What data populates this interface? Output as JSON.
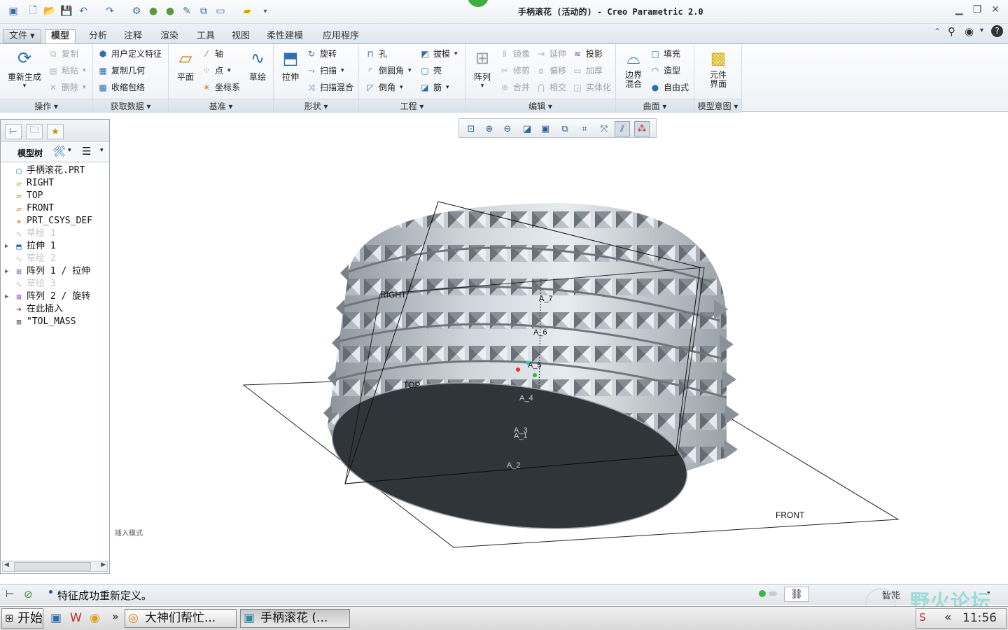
{
  "window": {
    "title": "手柄滚花 (活动的) - Creo Parametric 2.0"
  },
  "quick_access": [
    "app-icon",
    "new-icon",
    "open-icon",
    "save-icon",
    "undo-icon",
    "redo-icon",
    "regenerate-icon",
    "sphere-icon",
    "sphere-icon",
    "edit-icon",
    "copy-icon",
    "window-icon",
    "folder-icon",
    "more-icon"
  ],
  "tabs": {
    "file": "文件",
    "items": [
      "模型",
      "分析",
      "注释",
      "渲染",
      "工具",
      "视图",
      "柔性建模",
      "应用程序"
    ],
    "active": "模型"
  },
  "ribbon": {
    "operations": {
      "label": "操作",
      "regenerate": "重新生成",
      "copy": "复制",
      "paste": "粘贴",
      "delete": "删除"
    },
    "get_data": {
      "label": "获取数据",
      "udf": "用户定义特征",
      "copy_geom": "复制几何",
      "shrinkwrap": "收缩包络"
    },
    "datum": {
      "label": "基准",
      "plane": "平面",
      "axis": "轴",
      "point": "点",
      "csys": "坐标系",
      "sketch": "草绘"
    },
    "shapes": {
      "label": "形状",
      "extrude": "拉伸",
      "revolve": "旋转",
      "sweep": "扫描",
      "swept_blend": "扫描混合"
    },
    "engineering": {
      "label": "工程",
      "hole": "孔",
      "round": "倒圆角",
      "chamfer": "倒角",
      "draft": "拔模",
      "shell": "壳",
      "rib": "筋"
    },
    "editing": {
      "label": "编辑",
      "pattern": "阵列",
      "mirror": "镜像",
      "extend": "延伸",
      "project": "投影",
      "trim": "修剪",
      "offset": "偏移",
      "thicken": "加厚",
      "merge": "合并",
      "intersect": "相交",
      "solidify": "实体化"
    },
    "surfaces": {
      "label": "曲面",
      "boundary_blend": "边界\n混合",
      "fill": "填充",
      "style": "造型",
      "freestyle": "自由式"
    },
    "model_intent": {
      "label": "模型意图",
      "component_interface": "元件\n界面"
    }
  },
  "model_tree": {
    "header": "模型树",
    "items": [
      {
        "label": "手柄滚花.PRT",
        "icon": "part-icon",
        "expandable": false,
        "dim": false
      },
      {
        "label": "RIGHT",
        "icon": "datum-plane-icon",
        "expandable": false,
        "dim": false
      },
      {
        "label": "TOP",
        "icon": "datum-plane-icon",
        "expandable": false,
        "dim": false
      },
      {
        "label": "FRONT",
        "icon": "datum-plane-icon",
        "expandable": false,
        "dim": false
      },
      {
        "label": "PRT_CSYS_DEF",
        "icon": "csys-icon",
        "expandable": false,
        "dim": false
      },
      {
        "label": "草绘 1",
        "icon": "sketch-icon",
        "expandable": false,
        "dim": true
      },
      {
        "label": "拉伸 1",
        "icon": "extrude-icon",
        "expandable": true,
        "dim": false
      },
      {
        "label": "草绘 2",
        "icon": "sketch-icon",
        "expandable": false,
        "dim": true
      },
      {
        "label": "阵列 1 / 拉伸",
        "icon": "pattern-icon",
        "expandable": true,
        "dim": false
      },
      {
        "label": "草绘 3",
        "icon": "sketch-icon",
        "expandable": false,
        "dim": true
      },
      {
        "label": "阵列 2 / 旋转",
        "icon": "pattern-icon",
        "expandable": true,
        "dim": false
      },
      {
        "label": "在此插入",
        "icon": "insert-arrow-icon",
        "expandable": false,
        "dim": false
      },
      {
        "label": "\"TOL_MASS",
        "icon": "analysis-icon",
        "expandable": false,
        "dim": false
      }
    ]
  },
  "graphics": {
    "mode_label": "插入模式",
    "datum_labels": [
      "RIGHT",
      "TOP",
      "FRONT"
    ],
    "axis_labels": [
      "A_7",
      "A_6",
      "A_5",
      "A_4",
      "A_3",
      "A_1",
      "A_2"
    ]
  },
  "status": {
    "message": "特征成功重新定义。",
    "filter": "智能"
  },
  "taskbar": {
    "start": "开始",
    "items": [
      "大神们帮忙...",
      "手柄滚花 (..."
    ],
    "clock": "11:56"
  },
  "watermark": "野火论坛"
}
